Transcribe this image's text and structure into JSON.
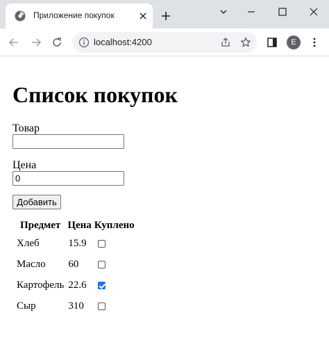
{
  "browser": {
    "tab_title": "Приложение покупок",
    "url": "localhost:4200",
    "avatar_letter": "E",
    "icons": [
      "favicon-icon",
      "close-icon",
      "new-tab-icon",
      "chevron-down-icon",
      "minimize-icon",
      "maximize-icon",
      "window-close-icon",
      "back-icon",
      "forward-icon",
      "reload-icon",
      "info-icon",
      "share-icon",
      "star-icon",
      "side-panel-icon",
      "menu-icon"
    ]
  },
  "page": {
    "title": "Список покупок",
    "item_label": "Товар",
    "item_value": "",
    "price_label": "Цена",
    "price_value": "0",
    "add_button": "Добавить",
    "table": {
      "headers": [
        "Предмет",
        "Цена",
        "Куплено"
      ],
      "rows": [
        {
          "name": "Хлеб",
          "price": "15.9",
          "bought": false
        },
        {
          "name": "Масло",
          "price": "60",
          "bought": false
        },
        {
          "name": "Картофель",
          "price": "22.6",
          "bought": true
        },
        {
          "name": "Сыр",
          "price": "310",
          "bought": false
        }
      ]
    }
  },
  "colors": {
    "checkbox_checked": "#1a73e8",
    "tabstrip": "#dee1e6"
  }
}
